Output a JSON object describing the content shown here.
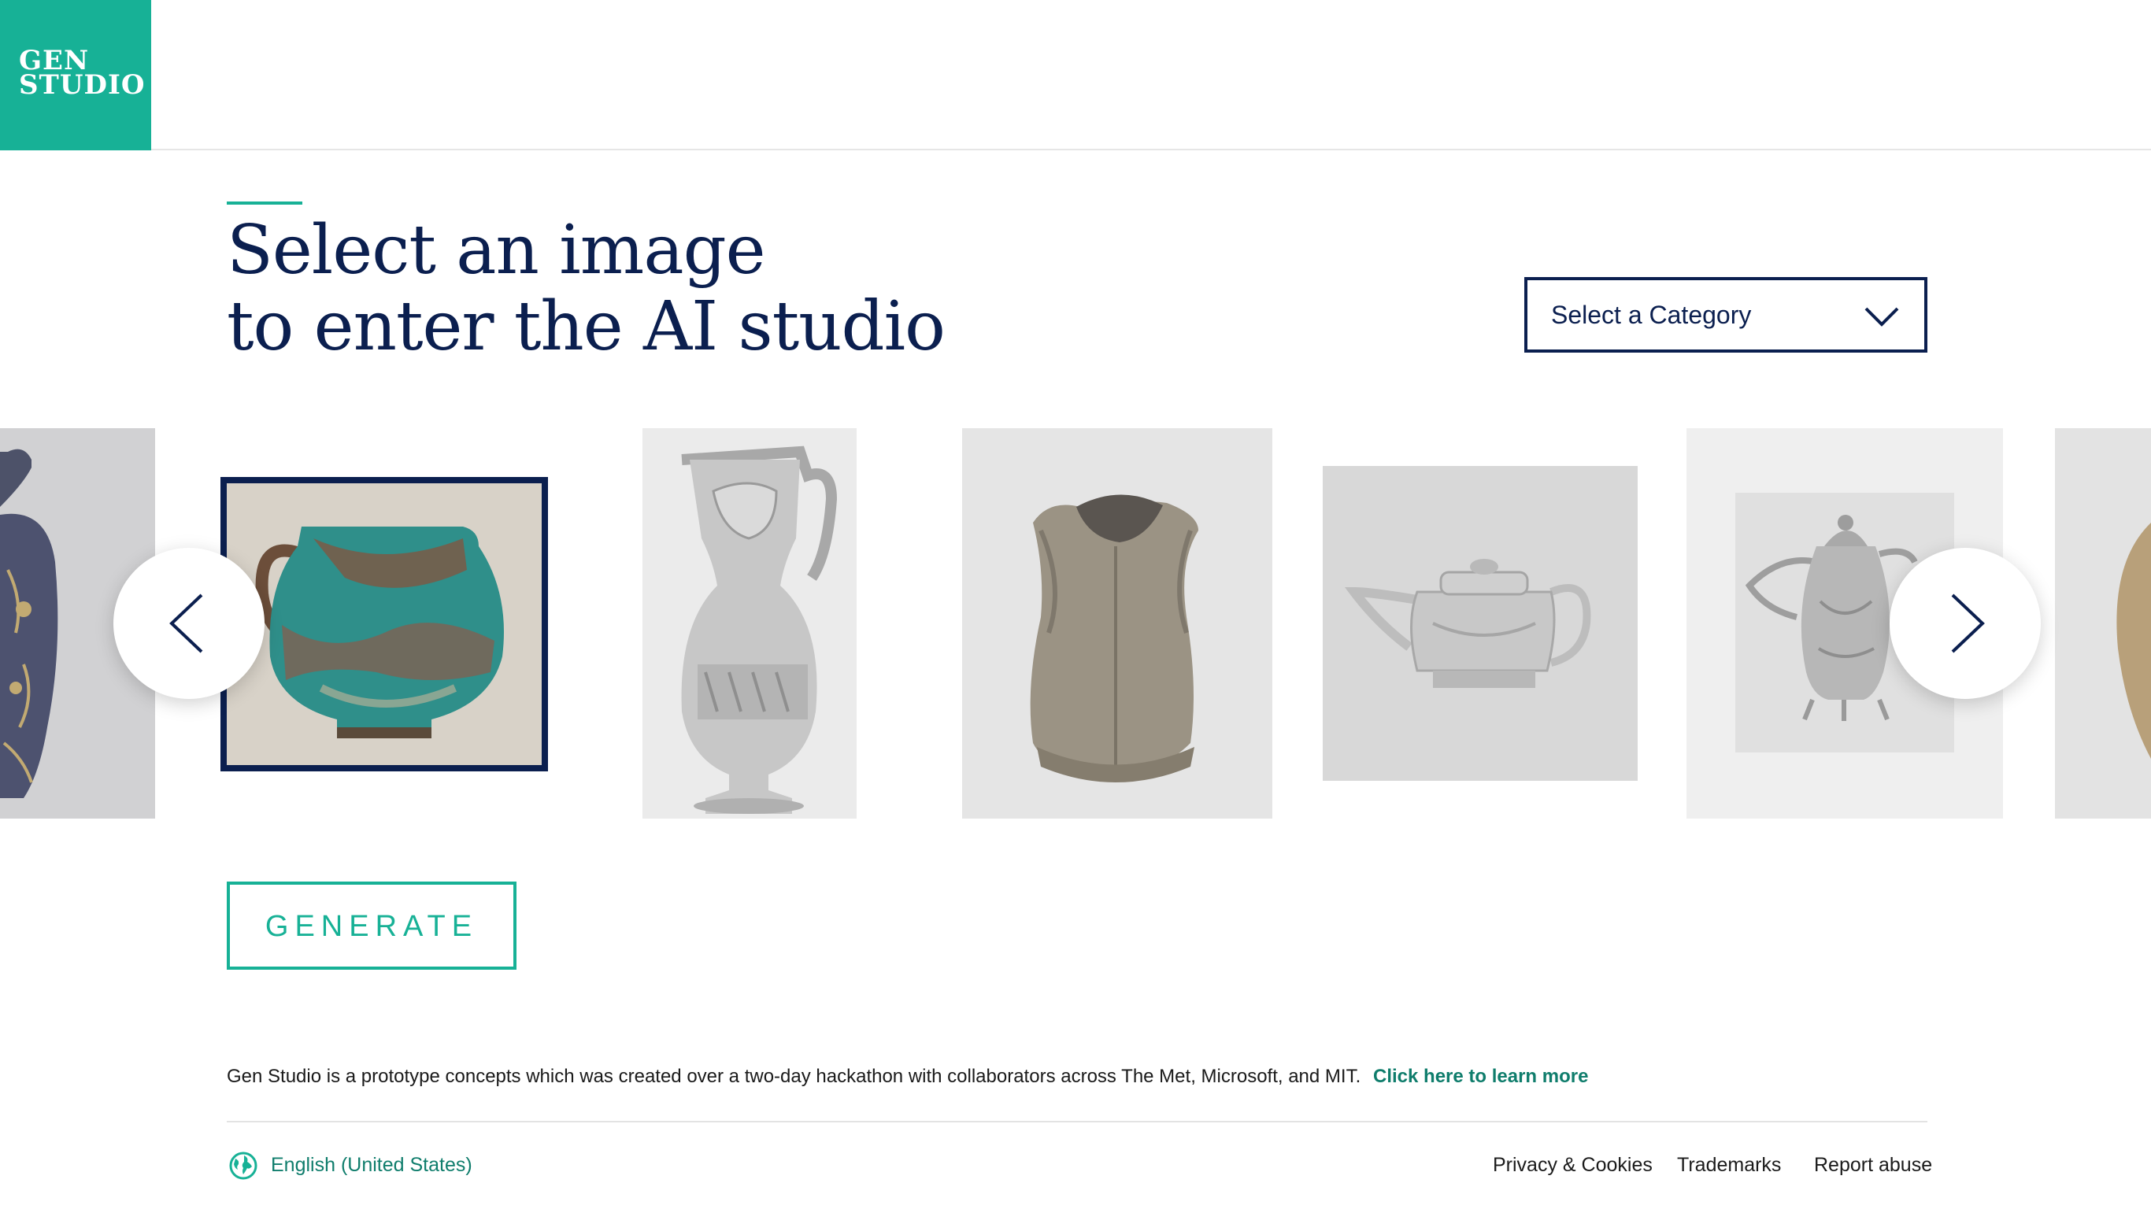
{
  "brand": {
    "line1": "GEN",
    "line2": "STUDIO",
    "accent": "#17b196",
    "navy": "#0b1f4f"
  },
  "title": {
    "line1": "Select an image",
    "line2": "to enter the AI studio"
  },
  "category": {
    "label": "Select a Category",
    "icon": "chevron-down-icon"
  },
  "carousel": {
    "prev_icon": "chevron-left-icon",
    "next_icon": "chevron-right-icon",
    "items": [
      {
        "name": "porcelain-vase"
      },
      {
        "name": "turquoise-jar",
        "selected": true
      },
      {
        "name": "silver-pitcher"
      },
      {
        "name": "breastplate-armor"
      },
      {
        "name": "silver-teapot"
      },
      {
        "name": "silver-coffee-pot"
      },
      {
        "name": "partial-item"
      }
    ]
  },
  "actions": {
    "generate": "GENERATE"
  },
  "info": {
    "text": "Gen Studio is a prototype concepts which was created over a two-day hackathon with collaborators across The Met, Microsoft, and MIT.",
    "link": "Click here to learn more"
  },
  "footer": {
    "language": "English (United States)",
    "globe_icon": "globe-icon",
    "links": [
      "Privacy & Cookies",
      "Trademarks",
      "Report abuse"
    ]
  }
}
